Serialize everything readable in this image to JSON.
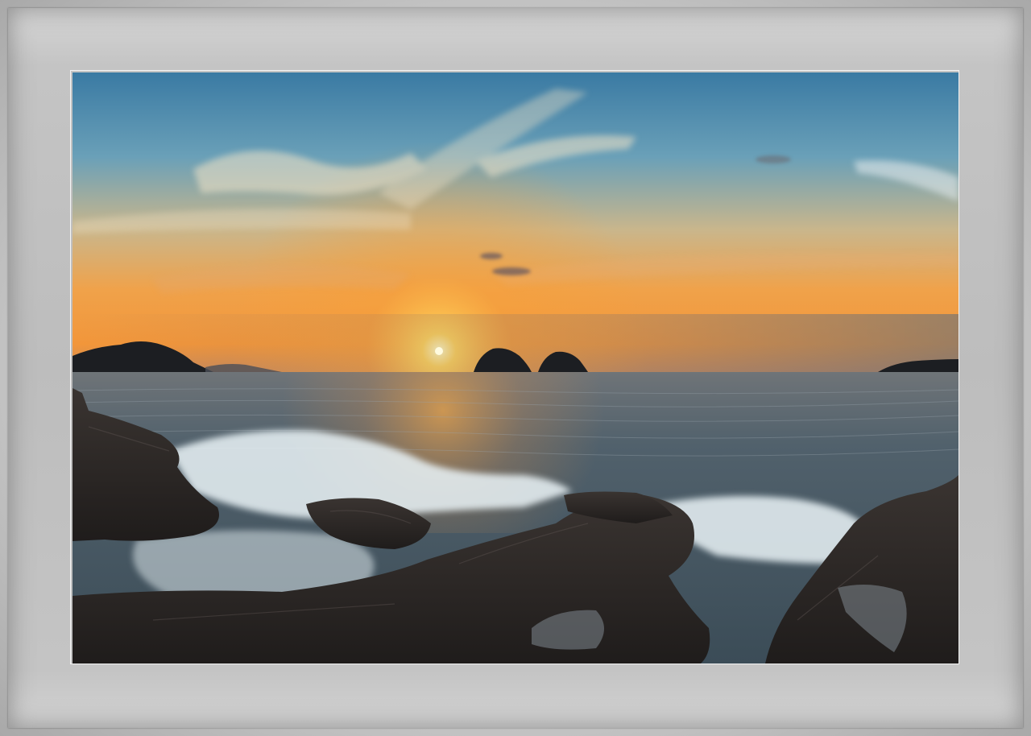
{
  "image": {
    "subject": "seascape",
    "colors": {
      "frame_outer": "#8c8c8c",
      "mat": "#c4c4c4",
      "sky_top": "#3f7fa5",
      "sky_horizon": "#f0a24a",
      "sun": "#fff3b0",
      "sea": "#4a5d6a",
      "rocks": "#2a2624",
      "foam": "#e8f2f6"
    }
  }
}
